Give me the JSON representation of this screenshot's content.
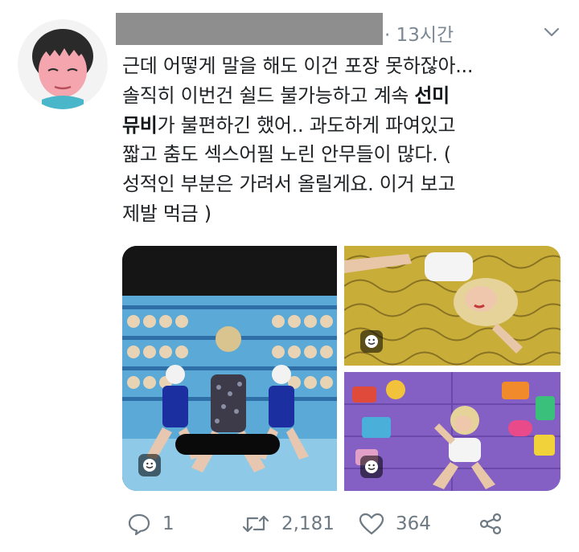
{
  "tweet": {
    "timestamp": "· 13시간",
    "lines": [
      {
        "pre": "근데 어떻게 말을 해도 이건 포장 못하잖아...",
        "bold": "",
        "post": ""
      },
      {
        "pre": "솔직히 이번건 쉴드 불가능하고 계속 ",
        "bold": "선미",
        "post": ""
      },
      {
        "pre": "",
        "bold": "뮤비",
        "post": "가 불편하긴 했어.. 과도하게 파여있고"
      },
      {
        "pre": "짧고 춤도 섹스어필 노린 안무들이 많다. (",
        "bold": "",
        "post": ""
      },
      {
        "pre": "성적인 부분은 가려서 올릴게요. 이거 보고",
        "bold": "",
        "post": ""
      },
      {
        "pre": "제발 먹금 )",
        "bold": "",
        "post": ""
      }
    ]
  },
  "actions": {
    "reply_count": "1",
    "retweet_count": "2,181",
    "like_count": "364"
  },
  "icons": {
    "chevron": "chevron-down-icon",
    "reply": "reply-icon",
    "retweet": "retweet-icon",
    "like": "heart-icon",
    "share": "share-icon",
    "gif": "smiley-icon"
  },
  "colors": {
    "text": "#14171a",
    "muted": "#7b8894",
    "redaction": "#8e8e8e"
  }
}
